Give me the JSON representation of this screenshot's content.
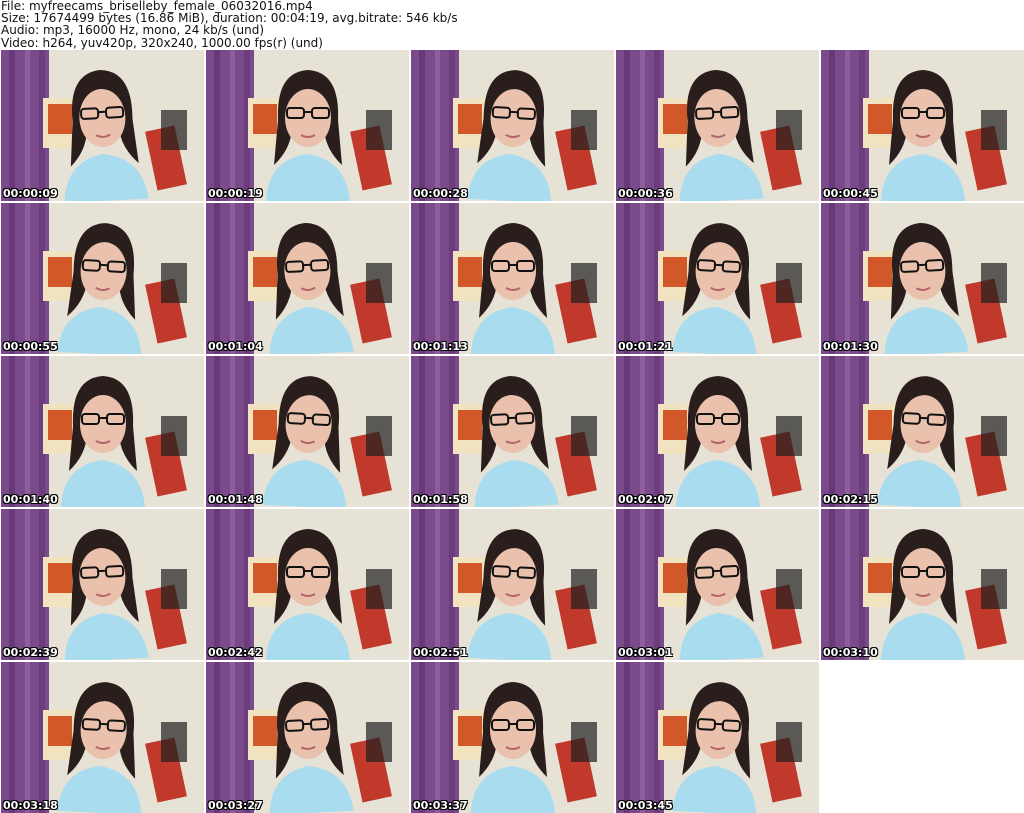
{
  "header": {
    "file_line": "File: myfreecams_briselleby_female_06032016.mp4",
    "size_line": "Size: 17674499 bytes (16.86 MiB), duration: 00:04:19, avg.bitrate: 546 kb/s",
    "audio_line": "Audio: mp3, 16000 Hz, mono, 24 kb/s (und)",
    "video_line": "Video: h264, yuv420p, 320x240, 1000.00 fps(r) (und)"
  },
  "colors": {
    "curtain": "#7a4a8a",
    "wall": "#e6e2d6",
    "shirt": "#a9dcef",
    "hair": "#2a1e1c",
    "skin": "#e9c1ad",
    "frame_red": "#c0392b"
  },
  "thumbnails": [
    {
      "timestamp": "00:00:09"
    },
    {
      "timestamp": "00:00:19"
    },
    {
      "timestamp": "00:00:28"
    },
    {
      "timestamp": "00:00:36"
    },
    {
      "timestamp": "00:00:45"
    },
    {
      "timestamp": "00:00:55"
    },
    {
      "timestamp": "00:01:04"
    },
    {
      "timestamp": "00:01:13"
    },
    {
      "timestamp": "00:01:21"
    },
    {
      "timestamp": "00:01:30"
    },
    {
      "timestamp": "00:01:40"
    },
    {
      "timestamp": "00:01:48"
    },
    {
      "timestamp": "00:01:58"
    },
    {
      "timestamp": "00:02:07"
    },
    {
      "timestamp": "00:02:15"
    },
    {
      "timestamp": "00:02:39"
    },
    {
      "timestamp": "00:02:42"
    },
    {
      "timestamp": "00:02:51"
    },
    {
      "timestamp": "00:03:01"
    },
    {
      "timestamp": "00:03:10"
    },
    {
      "timestamp": "00:03:18"
    },
    {
      "timestamp": "00:03:27"
    },
    {
      "timestamp": "00:03:37"
    },
    {
      "timestamp": "00:03:45"
    }
  ]
}
